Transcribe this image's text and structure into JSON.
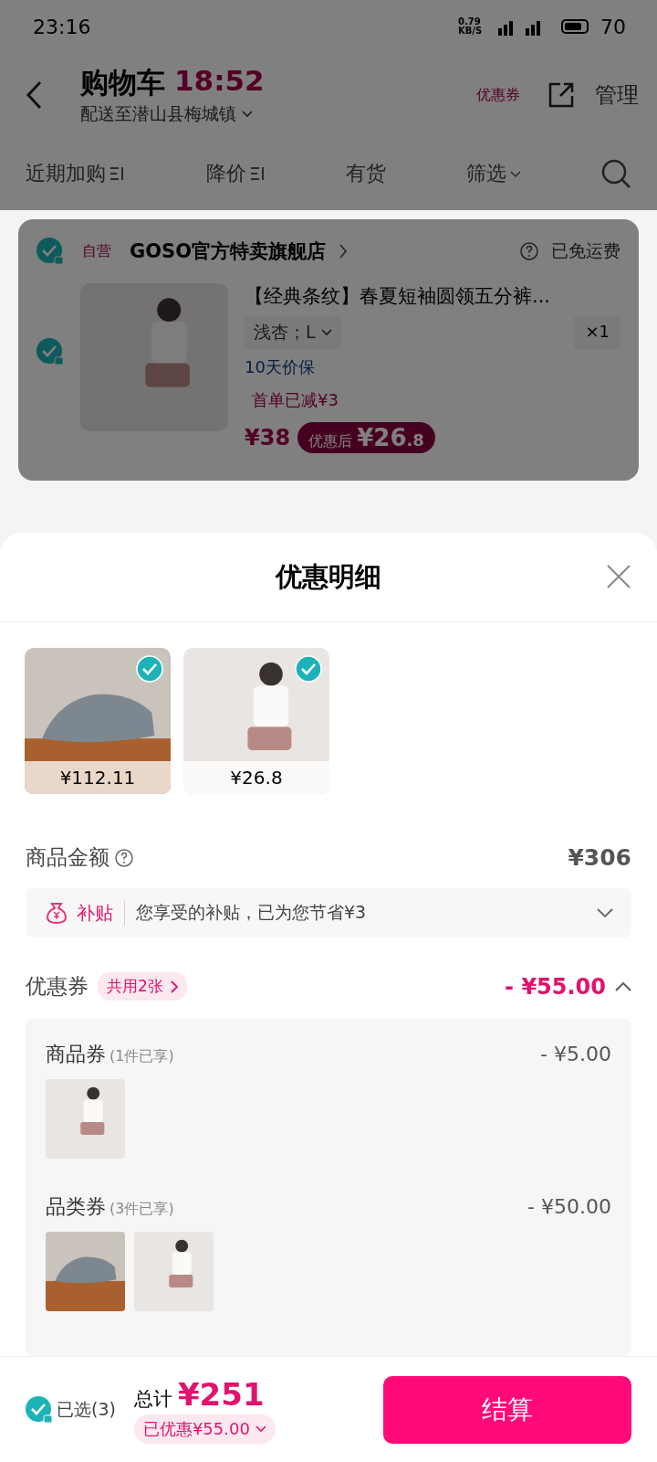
{
  "status_bar": {
    "time": "23:16",
    "net_speed": "0.79 KB/S",
    "battery": "70"
  },
  "header": {
    "title": "购物车",
    "timer": "18:52",
    "subtitle": "配送至潜山县梅城镇",
    "coupon_badge": "优惠券",
    "manage": "管理"
  },
  "filter_tabs": [
    {
      "label": "近期加购",
      "sortable": true
    },
    {
      "label": "降价",
      "sortable": true
    },
    {
      "label": "有货",
      "sortable": false
    },
    {
      "label": "筛选",
      "dropdown": true
    }
  ],
  "store": {
    "tag": "自营",
    "name": "GOSO官方特卖旗舰店",
    "shipping": "已免运费",
    "checked": true
  },
  "item": {
    "title": "【经典条纹】春夏短袖圆领五分裤...",
    "variant": "浅杏；L",
    "quantity": "×1",
    "guarantee": "10天价保",
    "promo": "首单已减¥3",
    "price": "¥38",
    "after_label": "优惠后",
    "after_price": "¥26",
    "after_decimal": ".8",
    "checked": true
  },
  "sheet": {
    "title": "优惠明细",
    "products": [
      {
        "kind": "shoes",
        "price": "¥112.11",
        "checked": true
      },
      {
        "kind": "pajamas",
        "price": "¥26.8",
        "checked": true
      }
    ],
    "subtotal_label": "商品金额",
    "subtotal": "¥306",
    "subsidy": {
      "label": "补贴",
      "text": "您享受的补贴，已为您节省¥3",
      "expanded": false
    },
    "coupon": {
      "label": "优惠券",
      "shared": "共用2张",
      "amount": "- ¥55.00",
      "expanded": true,
      "groups": [
        {
          "name": "商品券",
          "note": "(1件已享)",
          "amount": "- ¥5.00",
          "items": [
            {
              "kind": "pajamas"
            }
          ]
        },
        {
          "name": "品类券",
          "note": "(3件已享)",
          "amount": "- ¥50.00",
          "items": [
            {
              "kind": "shoes"
            },
            {
              "kind": "pajamas"
            }
          ]
        }
      ]
    }
  },
  "footer": {
    "selected_label": "已选(3)",
    "checked": true,
    "total_label": "总计",
    "total": "¥251",
    "saved": "已优惠¥55.00",
    "checkout": "结算"
  }
}
